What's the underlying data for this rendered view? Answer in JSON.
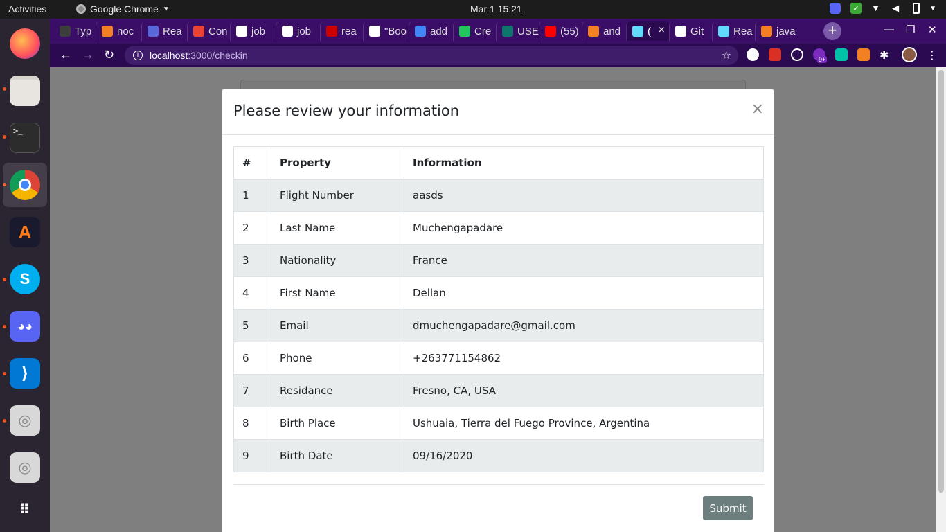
{
  "topbar": {
    "activities": "Activities",
    "app_name": "Google Chrome",
    "clock": "Mar 1  15:21"
  },
  "dock": {
    "apps": [
      "firefox-icon",
      "files-icon",
      "terminal-icon",
      "chrome-icon",
      "app-a-icon",
      "skype-icon",
      "discord-icon",
      "vscode-icon",
      "disk-icon",
      "disk-icon",
      "app-grid-icon"
    ]
  },
  "browser": {
    "tabs": [
      {
        "label": "Typ",
        "color": "#3d3d3d"
      },
      {
        "label": "noc",
        "color": "#f48024"
      },
      {
        "label": "Rea",
        "color": "#5a67d8"
      },
      {
        "label": "Con",
        "color": "#ea4335"
      },
      {
        "label": "job",
        "color": "#ffffff"
      },
      {
        "label": "job",
        "color": "#ffffff"
      },
      {
        "label": "rea",
        "color": "#cc0000"
      },
      {
        "label": "\"Boo",
        "color": "#ffffff"
      },
      {
        "label": "add",
        "color": "#4285f4"
      },
      {
        "label": "Cre",
        "color": "#22c55e"
      },
      {
        "label": "USE",
        "color": "#0f766e"
      },
      {
        "label": "(55)",
        "color": "#ff0000"
      },
      {
        "label": "and",
        "color": "#f48024"
      },
      {
        "label": "(",
        "color": "#61dafb"
      },
      {
        "label": "Git",
        "color": "#ffffff"
      },
      {
        "label": "Rea",
        "color": "#61dafb"
      },
      {
        "label": "java",
        "color": "#f48024"
      }
    ],
    "active_tab_index": 13,
    "new_tab": "+",
    "url_host": "localhost",
    "url_path": ":3000/checkin",
    "extensions_badge": "9+"
  },
  "modal": {
    "title": "Please review your information",
    "close": "×",
    "headers": [
      "#",
      "Property",
      "Information"
    ],
    "rows": [
      {
        "n": "1",
        "property": "Flight Number",
        "info": "aasds"
      },
      {
        "n": "2",
        "property": "Last Name",
        "info": "Muchengapadare"
      },
      {
        "n": "3",
        "property": "Nationality",
        "info": "France"
      },
      {
        "n": "4",
        "property": "First Name",
        "info": "Dellan"
      },
      {
        "n": "5",
        "property": "Email",
        "info": "dmuchengapadare@gmail.com"
      },
      {
        "n": "6",
        "property": "Phone",
        "info": "+263771154862"
      },
      {
        "n": "7",
        "property": "Residance",
        "info": "Fresno, CA, USA"
      },
      {
        "n": "8",
        "property": "Birth Place",
        "info": "Ushuaia, Tierra del Fuego Province, Argentina"
      },
      {
        "n": "9",
        "property": "Birth Date",
        "info": "09/16/2020"
      }
    ],
    "submit": "Submit"
  }
}
